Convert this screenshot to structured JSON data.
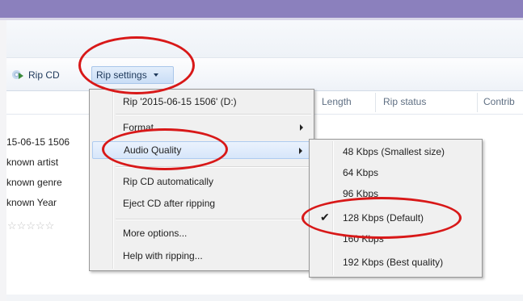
{
  "toolbar": {
    "rip_cd_label": "Rip CD",
    "rip_settings_label": "Rip settings"
  },
  "columns": {
    "length": "Length",
    "rip_status": "Rip status",
    "contrib": "Contrib"
  },
  "album_info": {
    "date": "15-06-15 1506",
    "artist": "known artist",
    "genre": "known genre",
    "year": "known Year",
    "rating_stars": "☆☆☆☆☆"
  },
  "rip_menu": {
    "rip_item": "Rip '2015-06-15 1506' (D:)",
    "format": "Format",
    "audio_quality": "Audio Quality",
    "rip_automatically": "Rip CD automatically",
    "eject_after": "Eject CD after ripping",
    "more_options": "More options...",
    "help": "Help with ripping..."
  },
  "quality_menu": {
    "items": [
      "48 Kbps (Smallest size)",
      "64 Kbps",
      "96 Kbps",
      "128 Kbps (Default)",
      "160 Kbps",
      "192 Kbps (Best quality)"
    ],
    "selected": "128 Kbps (Default)"
  },
  "colors": {
    "title_bar": "#8b80bd",
    "highlight_oval": "#d81818",
    "menu_hover": "#d7e6fa"
  }
}
